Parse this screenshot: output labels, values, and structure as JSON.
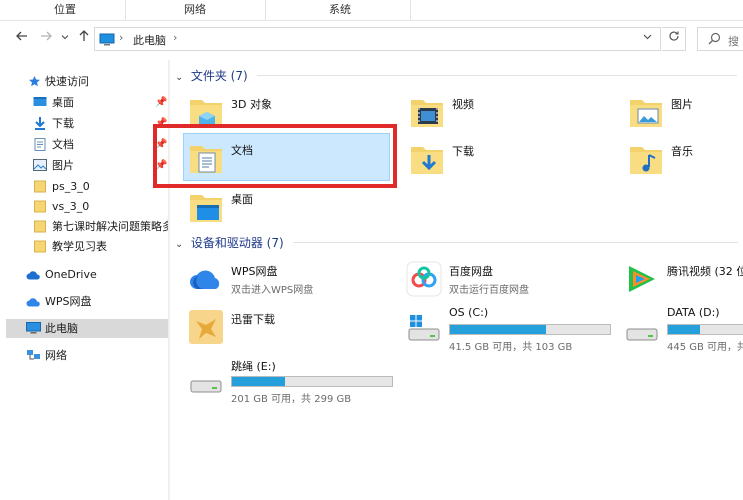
{
  "ribbon": {
    "tabs": [
      "位置",
      "网络",
      "系统"
    ]
  },
  "address": {
    "crumb": "此电脑",
    "search_placeholder": "搜"
  },
  "sidebar": {
    "items": [
      {
        "label": "快速访问",
        "icon": "star-icon"
      },
      {
        "label": "桌面",
        "icon": "desktop-icon"
      },
      {
        "label": "下载",
        "icon": "download-icon"
      },
      {
        "label": "文档",
        "icon": "document-icon"
      },
      {
        "label": "图片",
        "icon": "picture-icon"
      },
      {
        "label": "ps_3_0",
        "icon": "folder-icon"
      },
      {
        "label": "vs_3_0",
        "icon": "folder-icon"
      },
      {
        "label": "第七课时解决问题策略多样",
        "icon": "folder-icon"
      },
      {
        "label": "教学见习表",
        "icon": "folder-icon"
      },
      {
        "label": "OneDrive",
        "icon": "cloud-icon"
      },
      {
        "label": "WPS网盘",
        "icon": "wps-cloud-icon"
      },
      {
        "label": "此电脑",
        "icon": "computer-icon"
      },
      {
        "label": "网络",
        "icon": "network-icon"
      }
    ]
  },
  "folders_group": {
    "title": "文件夹 (7)",
    "items": [
      {
        "name": "3D 对象"
      },
      {
        "name": "视频"
      },
      {
        "name": "图片"
      },
      {
        "name": "文档"
      },
      {
        "name": "下载"
      },
      {
        "name": "音乐"
      },
      {
        "name": "桌面"
      }
    ]
  },
  "devices_group": {
    "title": "设备和驱动器 (7)",
    "items": [
      {
        "name": "WPS网盘",
        "sub": "双击进入WPS网盘"
      },
      {
        "name": "百度网盘",
        "sub": "双击运行百度网盘"
      },
      {
        "name": "腾讯视频 (32 位"
      },
      {
        "name": "迅雷下载"
      },
      {
        "name": "OS (C:)",
        "free": "41.5 GB 可用，共 103 GB",
        "used_fraction": 0.6
      },
      {
        "name": "DATA (D:)",
        "free": "445 GB 可用，共"
      },
      {
        "name": "跳绳 (E:)",
        "free": "201 GB 可用，共 299 GB",
        "used_fraction": 0.33
      }
    ]
  },
  "colors": {
    "accent": "#26a0da",
    "selection": "#cce8ff",
    "highlight_box": "#e02a2a"
  }
}
